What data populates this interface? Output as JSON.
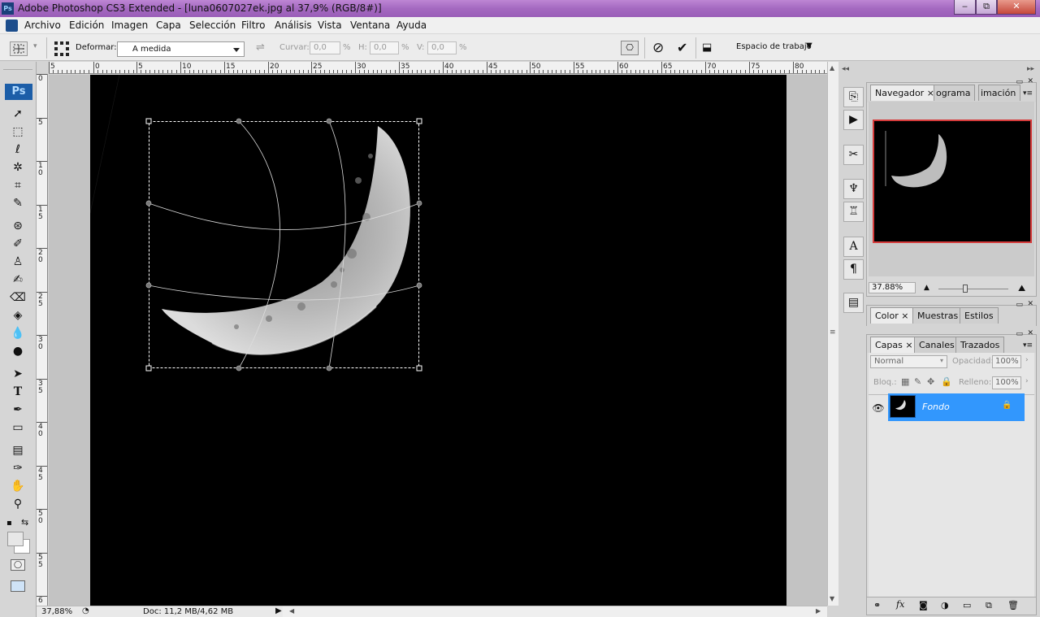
{
  "title": "Adobe Photoshop CS3 Extended - [luna0607027ek.jpg al 37,9% (RGB/8#)]",
  "ps_short": "Ps",
  "window_buttons": {
    "minimize": "‒",
    "restore": "⧉",
    "close": "✕"
  },
  "menu": [
    "Archivo",
    "Edición",
    "Imagen",
    "Capa",
    "Selección",
    "Filtro",
    "Análisis",
    "Vista",
    "Ventana",
    "Ayuda"
  ],
  "options": {
    "deform_label": "Deformar:",
    "deform_value": "A medida",
    "curve_label": "Curvar:",
    "curve_value": "0,0",
    "h_label": "H:",
    "h_value": "0,0",
    "v_label": "V:",
    "v_value": "0,0",
    "pct": "%",
    "workspace": "Espacio de trabajo"
  },
  "ruler_top": [
    "5",
    "0",
    "5",
    "10",
    "15",
    "20",
    "25",
    "30",
    "35",
    "40",
    "45",
    "50",
    "55",
    "60",
    "65",
    "70",
    "75",
    "80"
  ],
  "ruler_left": [
    "0",
    "5",
    "1\n0",
    "1\n5",
    "2\n0",
    "2\n5",
    "3\n0",
    "3\n5",
    "4\n0",
    "4\n5",
    "5\n0",
    "5\n5",
    "6"
  ],
  "status": {
    "zoom": "37,88%",
    "doc": "Doc: 11,2 MB/4,62 MB"
  },
  "navigator": {
    "tabs": [
      "Navegador",
      "ograma",
      "imación"
    ],
    "zoom": "37.88%"
  },
  "color_panel": {
    "tabs": [
      "Color",
      "Muestras",
      "Estilos"
    ]
  },
  "layers_panel": {
    "tabs": [
      "Capas",
      "Canales",
      "Trazados"
    ],
    "blend_mode": "Normal",
    "opacity_label": "Opacidad:",
    "opacity_value": "100%",
    "lock_label": "Bloq.:",
    "fill_label": "Relleno:",
    "fill_value": "100%",
    "layer_name": "Fondo"
  },
  "colors": {
    "title_bar": "#a469c0",
    "selected_layer": "#3297fd",
    "nav_frame": "#d63b3b"
  }
}
